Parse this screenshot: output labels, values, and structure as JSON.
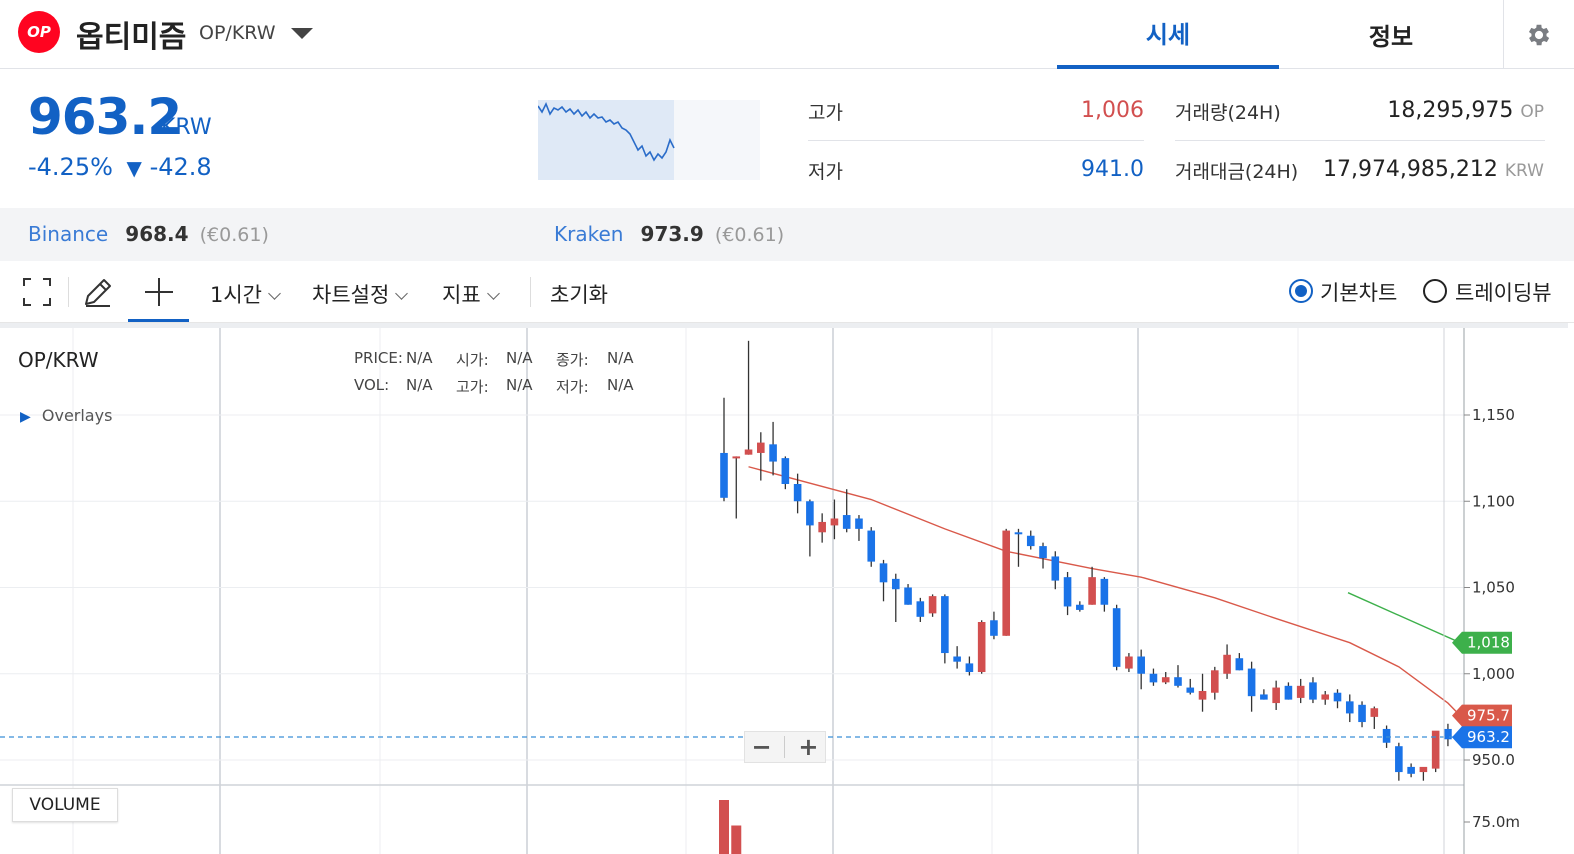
{
  "header": {
    "logo_text": "OP",
    "coin_name": "옵티미즘",
    "pair": "OP/KRW",
    "tabs": [
      {
        "label": "시세"
      },
      {
        "label": "정보"
      }
    ],
    "settings_icon": "gear-icon"
  },
  "price": {
    "current": "963.2",
    "unit": "KRW",
    "change_pct": "-4.25%",
    "change_arrow": "▼",
    "change_abs": "-42.8"
  },
  "stats": {
    "high_label": "고가",
    "high_value": "1,006",
    "low_label": "저가",
    "low_value": "941.0",
    "volume_label": "거래량(24H)",
    "volume_value": "18,295,975",
    "volume_unit": "OP",
    "amount_label": "거래대금(24H)",
    "amount_value": "17,974,985,212",
    "amount_unit": "KRW"
  },
  "exchanges": [
    {
      "name": "Binance",
      "price": "968.4",
      "sub": "(€0.61)"
    },
    {
      "name": "Kraken",
      "price": "973.9",
      "sub": "(€0.61)"
    }
  ],
  "toolbar": {
    "interval": "1시간",
    "chart_settings": "차트설정",
    "indicators": "지표",
    "reset": "초기화",
    "radio_basic": "기본차트",
    "radio_tv": "트레이딩뷰"
  },
  "chart": {
    "symbol": "OP/KRW",
    "overlays_label": "Overlays",
    "ohlc": {
      "price_label": "PRICE:",
      "price_value": "N/A",
      "open_label": "시가:",
      "open_value": "N/A",
      "close_label": "종가:",
      "close_value": "N/A",
      "vol_label": "VOL:",
      "vol_value": "N/A",
      "high_label": "고가:",
      "high_value": "N/A",
      "low_label": "저가:",
      "low_value": "N/A"
    },
    "volume_label": "VOLUME",
    "zoom_minus": "−",
    "zoom_plus": "+",
    "y_ticks": [
      "1,150",
      "1,100",
      "1,050",
      "1,000",
      "950.0"
    ],
    "vol_tick": "75.0m",
    "markers": {
      "green": "1,018",
      "red": "975.7",
      "blue": "963.2"
    },
    "colors": {
      "up": "#d24f4f",
      "down": "#1a73e8",
      "ma_red": "#d9594a",
      "ma_green": "#3db04b",
      "accent": "#1261c4"
    }
  },
  "chart_data": {
    "type": "candlestick",
    "y_ticks": [
      1150,
      1100,
      1050,
      1000,
      950
    ],
    "ylim": [
      935,
      1195
    ],
    "candles": [
      [
        1128,
        1160,
        1100,
        1102
      ],
      [
        1126,
        1126,
        1090,
        1126
      ],
      [
        1127,
        1193,
        1127,
        1130
      ],
      [
        1128,
        1140,
        1112,
        1134
      ],
      [
        1133,
        1146,
        1115,
        1123
      ],
      [
        1125,
        1126,
        1107,
        1110
      ],
      [
        1110,
        1116,
        1093,
        1100
      ],
      [
        1100,
        1101,
        1068,
        1086
      ],
      [
        1082,
        1093,
        1076,
        1088
      ],
      [
        1086,
        1101,
        1078,
        1090
      ],
      [
        1092,
        1107,
        1082,
        1084
      ],
      [
        1090,
        1092,
        1077,
        1084
      ],
      [
        1083,
        1085,
        1062,
        1065
      ],
      [
        1064,
        1066,
        1042,
        1053
      ],
      [
        1055,
        1058,
        1030,
        1049
      ],
      [
        1050,
        1052,
        1040,
        1040
      ],
      [
        1042,
        1044,
        1030,
        1033
      ],
      [
        1035,
        1046,
        1033,
        1045
      ],
      [
        1045,
        1046,
        1006,
        1012
      ],
      [
        1010,
        1016,
        1003,
        1007
      ],
      [
        1006,
        1010,
        999,
        1001
      ],
      [
        1001,
        1031,
        1000,
        1030
      ],
      [
        1031,
        1036,
        1020,
        1022
      ],
      [
        1022,
        1084,
        1022,
        1083
      ],
      [
        1082,
        1084,
        1062,
        1081
      ],
      [
        1080,
        1083,
        1072,
        1074
      ],
      [
        1074,
        1076,
        1061,
        1067
      ],
      [
        1068,
        1071,
        1049,
        1054
      ],
      [
        1056,
        1059,
        1034,
        1039
      ],
      [
        1040,
        1042,
        1036,
        1037
      ],
      [
        1040,
        1062,
        1040,
        1056
      ],
      [
        1055,
        1056,
        1036,
        1040
      ],
      [
        1038,
        1040,
        1002,
        1004
      ],
      [
        1003,
        1012,
        1001,
        1010
      ],
      [
        1010,
        1014,
        991,
        1000
      ],
      [
        1000,
        1003,
        993,
        995
      ],
      [
        995,
        1001,
        994,
        998
      ],
      [
        998,
        1005,
        992,
        993
      ],
      [
        992,
        997,
        988,
        989
      ],
      [
        985,
        1000,
        978,
        990
      ],
      [
        989,
        1004,
        985,
        1002
      ],
      [
        1000,
        1017,
        997,
        1011
      ],
      [
        1009,
        1012,
        1002,
        1002
      ],
      [
        1003,
        1007,
        978,
        987
      ],
      [
        988,
        991,
        985,
        985
      ],
      [
        983,
        996,
        979,
        992
      ],
      [
        993,
        995,
        985,
        985
      ],
      [
        986,
        997,
        983,
        993
      ],
      [
        995,
        998,
        983,
        985
      ],
      [
        985,
        990,
        982,
        988
      ],
      [
        989,
        991,
        980,
        984
      ],
      [
        984,
        988,
        972,
        977
      ],
      [
        982,
        984,
        969,
        972
      ],
      [
        975,
        981,
        968,
        980
      ],
      [
        968,
        970,
        957,
        960
      ],
      [
        958,
        960,
        938,
        943
      ],
      [
        946,
        948,
        940,
        942
      ],
      [
        943,
        945,
        938,
        946
      ],
      [
        945,
        966,
        943,
        967
      ],
      [
        968,
        971,
        958,
        962
      ]
    ],
    "ma_red": [
      [
        1120,
        2
      ],
      [
        1101,
        12
      ],
      [
        1084,
        18
      ],
      [
        1071,
        23
      ],
      [
        1061,
        30
      ],
      [
        1056,
        34
      ],
      [
        1044,
        40
      ],
      [
        1032,
        45
      ],
      [
        1018,
        51
      ],
      [
        1004,
        55
      ],
      [
        983,
        59
      ],
      [
        975.7,
        60
      ]
    ],
    "ma_green": [
      [
        1047,
        48
      ],
      [
        1018,
        60
      ]
    ],
    "volume": [
      [
        1,
        2
      ],
      [
        0.25,
        3
      ]
    ]
  }
}
